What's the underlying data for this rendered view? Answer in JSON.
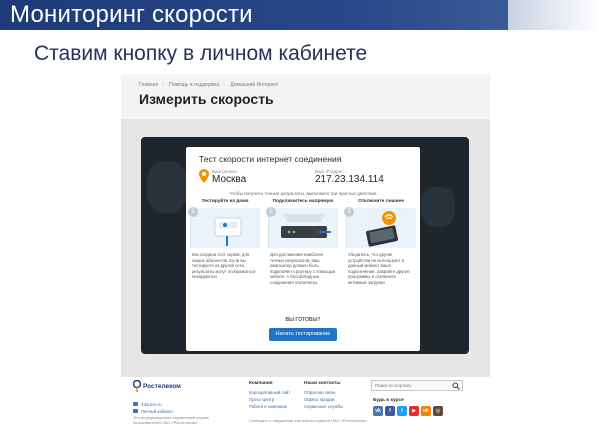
{
  "slide": {
    "title": "Мониторинг скорости",
    "subtitle": "Ставим кнопку в личном кабинете"
  },
  "site": {
    "breadcrumb": [
      "Главная",
      "Помощь и поддержка",
      "Домашний Интернет"
    ],
    "page_title": "Измерить скорость",
    "card": {
      "title": "Тест скорости интернет соединения",
      "region_label": "Ваш регион:",
      "region_value": "Москва",
      "ip_label": "Ваш IP-адрес:",
      "ip_value": "217.23.134.114",
      "steps_intro": "Чтобы получить точные результаты, выполните три простых действия",
      "steps": [
        {
          "number": "1",
          "title": "Тестируйте из дома",
          "text": "Мы создали этот сервис для наших абонентов. Если вы тестируете из другой сети, результаты могут отображаться некорректно"
        },
        {
          "number": "2",
          "title": "Подключитесь напрямую",
          "text": "Для достижения наиболее точных результатов, ваш компьютер должен быть подключен к роутеру с помощью кабеля. А беспроводные соединения отключены."
        },
        {
          "number": "3",
          "title": "Отключите лишнее",
          "text": "Убедитесь, что другие устройства не используют в данный момент ваше подключение. Закройте другие программы и отключите активные загрузки"
        }
      ],
      "ready_label": "ВЫ ГОТОВЫ?",
      "start_button": "Начать тестирование"
    },
    "footer": {
      "logo_text": "Ростелеком",
      "link_zdorovo": "Zdorovo.ru",
      "link_cabinet": "Личный кабинет",
      "note": "Это информационно-справочный сервис пользователей ПАО «Ростелеком»",
      "company_heading": "Компания",
      "company_links": [
        "Корпоративный сайт",
        "Пресс-центр",
        "Работа в компании"
      ],
      "contacts_heading": "Наши контакты",
      "contacts_links": [
        "Обратная связь",
        "Офисы продаж",
        "Сервисные службы"
      ],
      "small_print": "Сообщить о нарушении этического кодекса ПАО «Ростелеком»",
      "search_placeholder": "Поиск по порталу",
      "social_heading": "Будь в курсе",
      "social": [
        {
          "icon": "vk-icon",
          "glyph": "vk",
          "color": "#4a76a8"
        },
        {
          "icon": "facebook-icon",
          "glyph": "f",
          "color": "#3b5998"
        },
        {
          "icon": "twitter-icon",
          "glyph": "t",
          "color": "#1da1f2"
        },
        {
          "icon": "youtube-icon",
          "glyph": "▶",
          "color": "#e52d27"
        },
        {
          "icon": "odnoklassniki-icon",
          "glyph": "ok",
          "color": "#ee8208"
        },
        {
          "icon": "instagram-icon",
          "glyph": "◎",
          "color": "#5d4c3e"
        }
      ]
    }
  },
  "colors": {
    "title_bar": "#27488a",
    "accent_blue": "#1d76c6",
    "orange": "#f39200"
  }
}
